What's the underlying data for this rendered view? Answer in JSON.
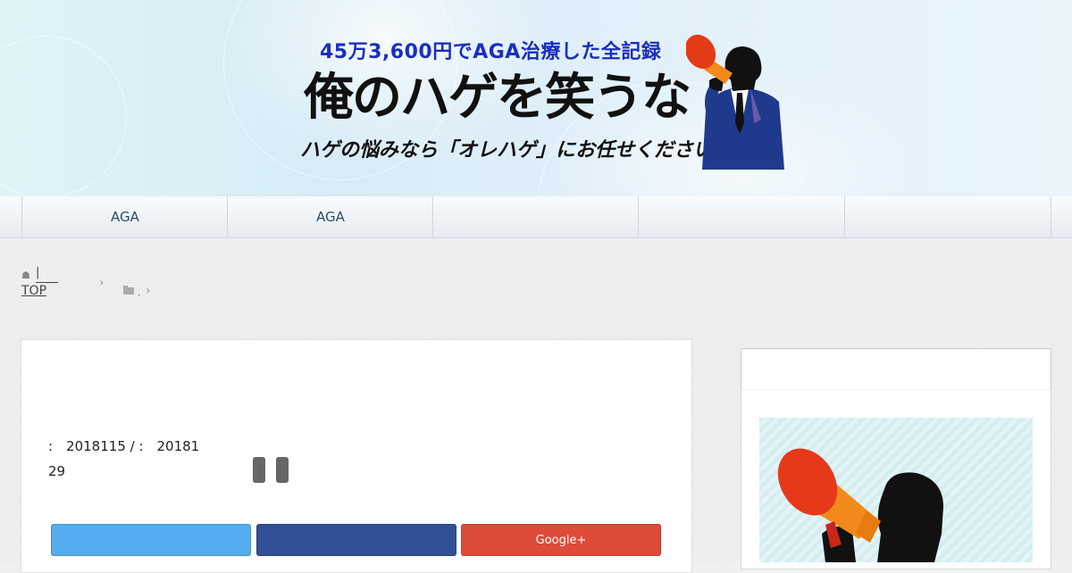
{
  "header": {
    "catchphrase": "45万3,600円でAGA治療した全記録",
    "site_title": "俺のハゲを笑うな",
    "tagline": "ハゲの悩みなら「オレハゲ」にお任せください。"
  },
  "nav": {
    "items": [
      {
        "label": "AGA"
      },
      {
        "label": "AGA"
      },
      {
        "label": ""
      },
      {
        "label": ""
      },
      {
        "label": ""
      }
    ]
  },
  "breadcrumb": {
    "link1": "|",
    "link2": "TOP",
    "sep": "›",
    "category": ","
  },
  "article": {
    "dates_line1": ":　2018115 / :　20181",
    "dates_line2": "29"
  },
  "share": {
    "twitter": "",
    "facebook": "",
    "google": "Google+"
  },
  "colors": {
    "catchphrase": "#1c2ec0",
    "twitter": "#55acee",
    "facebook": "#315096",
    "google": "#dd4b39"
  },
  "icons": [
    "home-icon",
    "folder-icon",
    "chevron-right-icon",
    "megaphone-icon"
  ]
}
